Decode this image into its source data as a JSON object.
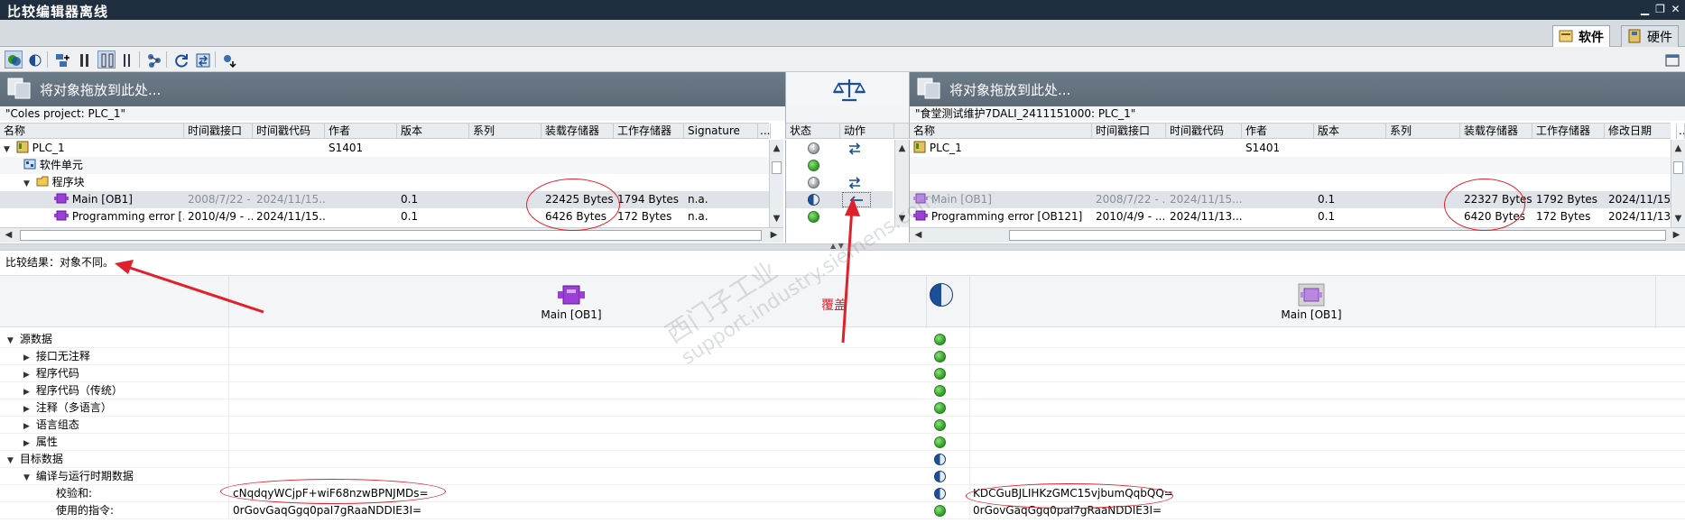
{
  "window": {
    "title": "比较编辑器离线",
    "minimize": "▁",
    "restore": "❐",
    "close": "✕"
  },
  "tabs": [
    {
      "label": "软件",
      "active": true
    },
    {
      "label": "硬件",
      "active": false
    }
  ],
  "left": {
    "drop_hint": "将对象拖放到此处...",
    "project": "\"Coles project: PLC_1\"",
    "columns": [
      "名称",
      "时间戳接口",
      "时间戳代码",
      "作者",
      "版本",
      "系列",
      "装载存储器",
      "工作存储器",
      "Signature",
      "..."
    ],
    "rows": [
      {
        "name": "PLC_1",
        "iface": "",
        "code": "",
        "author": "S1401",
        "ver": "",
        "fam": "",
        "load": "",
        "work": "",
        "sig": ""
      },
      {
        "name": "软件单元",
        "iface": "",
        "code": "",
        "author": "",
        "ver": "",
        "fam": "",
        "load": "",
        "work": "",
        "sig": ""
      },
      {
        "name": "程序块",
        "iface": "",
        "code": "",
        "author": "",
        "ver": "",
        "fam": "",
        "load": "",
        "work": "",
        "sig": ""
      },
      {
        "name": "Main [OB1]",
        "iface": "2008/7/22 - ...",
        "code": "2024/11/15...",
        "author": "",
        "ver": "0.1",
        "fam": "",
        "load": "22425 Bytes",
        "work": "1794 Bytes",
        "sig": "n.a."
      },
      {
        "name": "Programming error [...",
        "iface": "2010/4/9 - ...",
        "code": "2024/11/15...",
        "author": "",
        "ver": "0.1",
        "fam": "",
        "load": "6426 Bytes",
        "work": "172 Bytes",
        "sig": "n.a."
      }
    ]
  },
  "middle": {
    "columns": [
      "状态",
      "动作"
    ]
  },
  "right": {
    "drop_hint": "将对象拖放到此处...",
    "project": "\"食堂测试维护7DALI_2411151000: PLC_1\"",
    "columns": [
      "名称",
      "时间戳接口",
      "时间戳代码",
      "作者",
      "版本",
      "系列",
      "装载存储器",
      "工作存储器",
      "修改日期",
      "..."
    ],
    "rows": [
      {
        "name": "PLC_1",
        "iface": "",
        "code": "",
        "author": "S1401",
        "ver": "",
        "fam": "",
        "load": "",
        "work": "",
        "mod": ""
      },
      {
        "name": "Main [OB1]",
        "iface": "2008/7/22 - ...",
        "code": "2024/11/15...",
        "author": "",
        "ver": "0.1",
        "fam": "",
        "load": "22327 Bytes",
        "work": "1792 Bytes",
        "mod": "2024/11/15..."
      },
      {
        "name": "Programming error [OB121]",
        "iface": "2010/4/9 - ...",
        "code": "2024/11/13...",
        "author": "",
        "ver": "0.1",
        "fam": "",
        "load": "6420 Bytes",
        "work": "172 Bytes",
        "mod": "2024/11/13..."
      }
    ]
  },
  "compare": {
    "result": "比较结果：对象不同。",
    "left_object": "Main [OB1]",
    "right_object": "Main [OB1]",
    "annotation": "覆盖",
    "sections": [
      {
        "label": "源数据",
        "level": 0,
        "expanded": true,
        "status": "green"
      },
      {
        "label": "接口无注释",
        "level": 1,
        "expanded": false,
        "status": "green"
      },
      {
        "label": "程序代码",
        "level": 1,
        "expanded": false,
        "status": "green"
      },
      {
        "label": "程序代码（传统）",
        "level": 1,
        "expanded": false,
        "status": "green"
      },
      {
        "label": "注释（多语言）",
        "level": 1,
        "expanded": false,
        "status": "green"
      },
      {
        "label": "语言组态",
        "level": 1,
        "expanded": false,
        "status": "green"
      },
      {
        "label": "属性",
        "level": 1,
        "expanded": false,
        "status": "green"
      },
      {
        "label": "目标数据",
        "level": 0,
        "expanded": true,
        "status": "half"
      },
      {
        "label": "编译与运行时期数据",
        "level": 1,
        "expanded": true,
        "status": "half"
      },
      {
        "label": "校验和:",
        "level": 2,
        "expanded": null,
        "status": "half",
        "left": "cNqdqyWCjpF+wiF68nzwBPNJMDs=",
        "right": "KDCGuBJLIHKzGMC15vjbumQqbQQ="
      },
      {
        "label": "使用的指令:",
        "level": 2,
        "expanded": null,
        "status": "green",
        "left": "0rGovGaqGgq0paI7gRaaNDDIE3I=",
        "right": "0rGovGaqGgq0paI7gRaaNDDIE3I="
      }
    ]
  },
  "watermark": {
    "line1": "西门子工业",
    "line2": "support.industry.siemens.com"
  },
  "colors": {
    "titlebar": "#1f2f3f",
    "drop_header": "#64737f",
    "annotation_red": "#e0202a",
    "ok_green": "#2a9a22",
    "diff_blue": "#1d4f99"
  }
}
